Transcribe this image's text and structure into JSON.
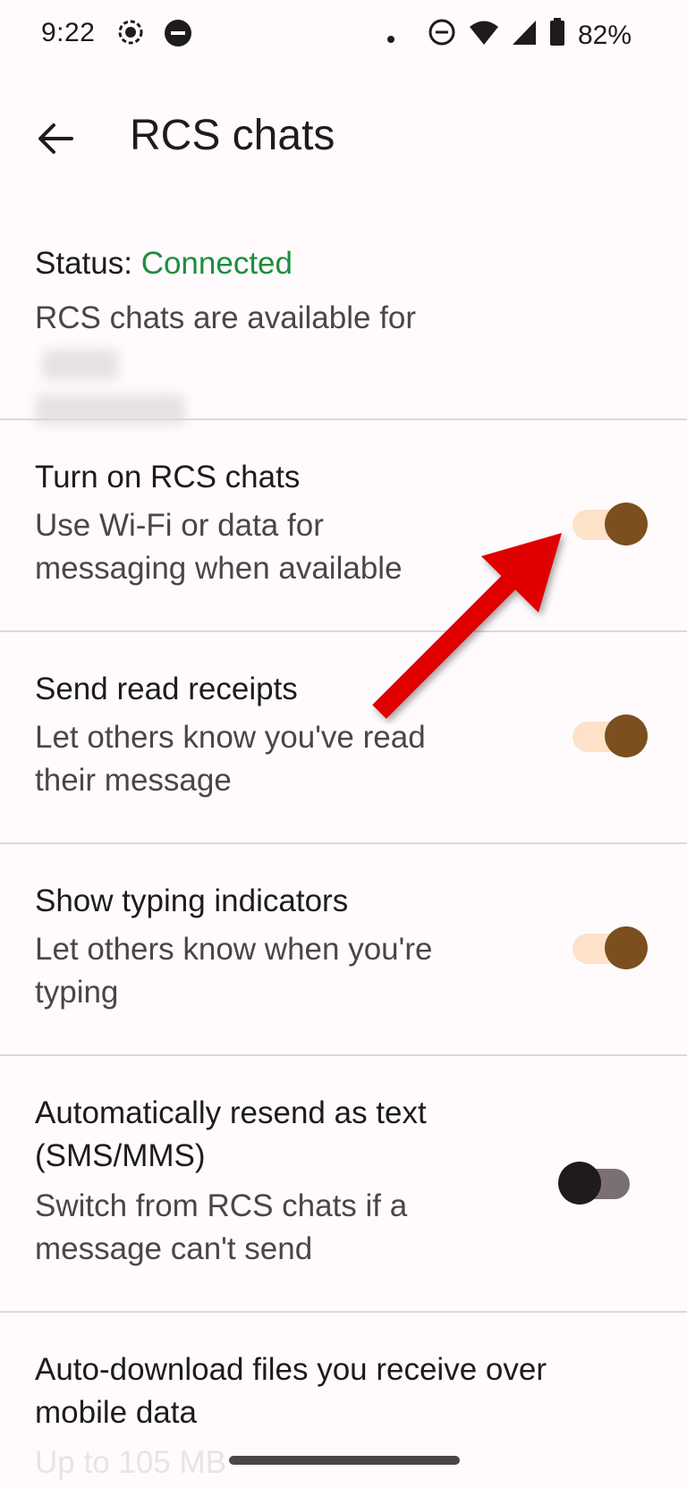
{
  "status_bar": {
    "time": "9:22",
    "battery": "82%",
    "icons": [
      "screen-record-icon",
      "dnd-icon",
      "dot-icon",
      "dnd-circle-icon",
      "wifi-icon",
      "signal-icon",
      "battery-icon"
    ]
  },
  "app_bar": {
    "title": "RCS chats",
    "back_icon": "back-arrow-icon"
  },
  "status": {
    "label": "Status:",
    "value": "Connected",
    "description": "RCS chats are available for"
  },
  "settings": [
    {
      "title": "Turn on RCS chats",
      "subtitle": "Use Wi-Fi or data for messaging when available",
      "on": true
    },
    {
      "title": "Send read receipts",
      "subtitle": "Let others know you've read their message",
      "on": true
    },
    {
      "title": "Show typing indicators",
      "subtitle": "Let others know when you're typing",
      "on": true
    },
    {
      "title": "Automatically resend as text (SMS/MMS)",
      "subtitle": "Switch from RCS chats if a message can't send",
      "on": false
    },
    {
      "title": "Auto-download files you receive over mobile data",
      "subtitle": "Up to 105 MB"
    }
  ],
  "colors": {
    "background": "#fffbfd",
    "connected": "#1e8e3e",
    "toggle_thumb_on": "#7b4f1e",
    "toggle_track_on": "#fde2c9",
    "toggle_thumb_off": "#1f1b1c",
    "toggle_track_off": "#7a7073",
    "annotation_arrow": "#e00000"
  }
}
